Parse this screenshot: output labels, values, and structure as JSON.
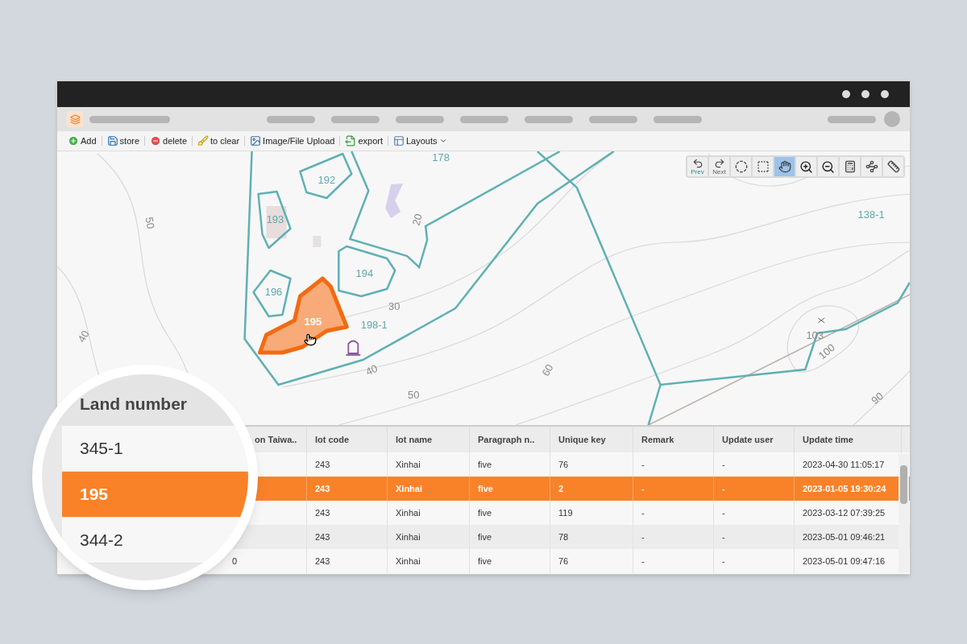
{
  "toolbar": [
    {
      "kind": "add",
      "label": "Add"
    },
    {
      "kind": "store",
      "label": "store"
    },
    {
      "kind": "delete",
      "label": "delete"
    },
    {
      "kind": "clear",
      "label": "to clear"
    },
    {
      "kind": "upload",
      "label": "Image/File Upload"
    },
    {
      "kind": "export",
      "label": "export"
    },
    {
      "kind": "layouts",
      "label": "Layouts",
      "dropdown": true
    }
  ],
  "map_tools": [
    {
      "kind": "prev",
      "label": "Prev",
      "selected": false
    },
    {
      "kind": "next",
      "label": "Next",
      "selected": false
    },
    {
      "kind": "lasso",
      "selected": false
    },
    {
      "kind": "box",
      "selected": false
    },
    {
      "kind": "pan",
      "selected": true
    },
    {
      "kind": "zoom_in",
      "selected": false
    },
    {
      "kind": "zoom_out",
      "selected": false
    },
    {
      "kind": "calculator",
      "selected": false
    },
    {
      "kind": "polygon",
      "selected": false
    },
    {
      "kind": "measure",
      "selected": false
    }
  ],
  "map": {
    "parcels": [
      {
        "label": "192",
        "selected": false
      },
      {
        "label": "193",
        "selected": false
      },
      {
        "label": "194",
        "selected": false
      },
      {
        "label": "196",
        "selected": false
      },
      {
        "label": "195",
        "selected": true
      }
    ],
    "area_labels": [
      "198-1",
      "178",
      "138-1"
    ],
    "contour_labels": [
      "50",
      "40",
      "20",
      "30",
      "40",
      "50",
      "60",
      "103",
      "100",
      "90"
    ]
  },
  "table": {
    "columns": [
      "on Taiwa..",
      "lot code",
      "lot name",
      "Paragraph n..",
      "Unique key",
      "Remark",
      "Update user",
      "Update time"
    ],
    "rows": [
      {
        "selected": false,
        "cells": [
          "",
          "243",
          "Xinhai",
          "five",
          "76",
          "-",
          "-",
          "2023-04-30 11:05:17"
        ]
      },
      {
        "selected": true,
        "cells": [
          "",
          "243",
          "Xinhai",
          "five",
          "2",
          "-",
          "-",
          "2023-01-05 19:30:24"
        ]
      },
      {
        "selected": false,
        "cells": [
          "",
          "243",
          "Xinhai",
          "five",
          "119",
          "-",
          "-",
          "2023-03-12 07:39:25"
        ]
      },
      {
        "selected": false,
        "cells": [
          "",
          "243",
          "Xinhai",
          "five",
          "78",
          "-",
          "-",
          "2023-05-01 09:46:21"
        ]
      },
      {
        "selected": false,
        "cells": [
          "0",
          "243",
          "Xinhai",
          "five",
          "76",
          "-",
          "-",
          "2023-05-01 09:47:16"
        ]
      }
    ]
  },
  "magnifier": {
    "header": "Land number",
    "rows": [
      {
        "text": "345-1",
        "selected": false
      },
      {
        "text": "195",
        "selected": true
      },
      {
        "text": "344-2",
        "selected": false
      }
    ]
  }
}
